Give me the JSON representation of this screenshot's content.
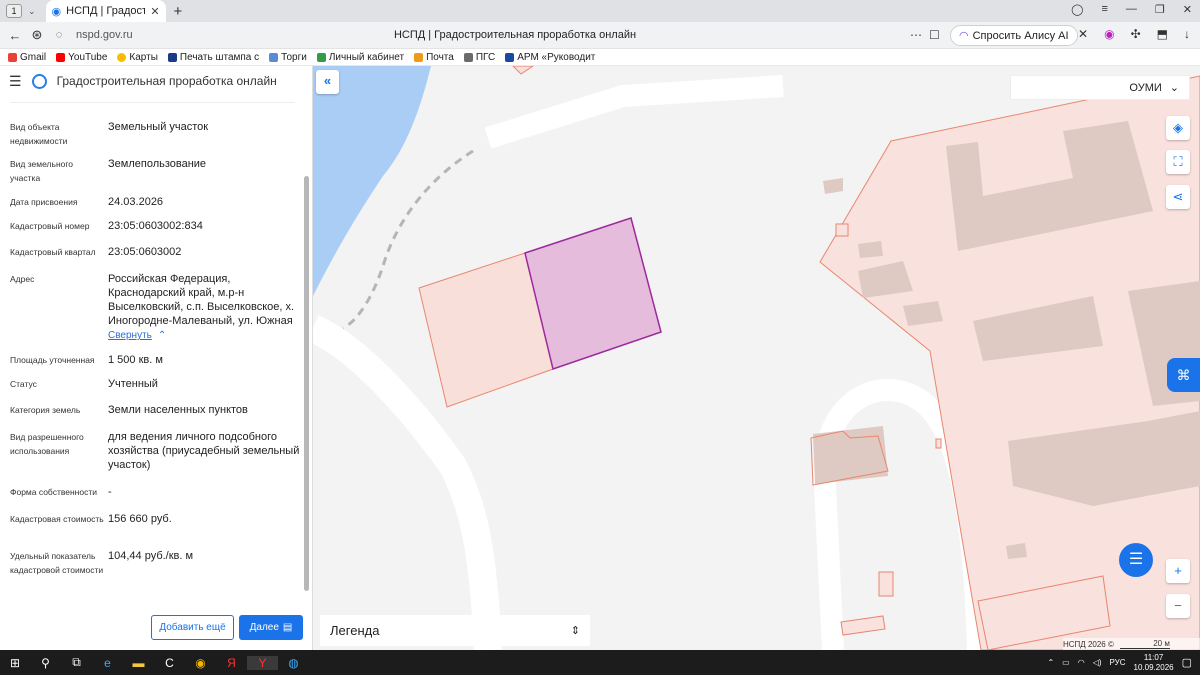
{
  "browser": {
    "tab_number": "1",
    "tab_title": "НСПД | Градостроительная проработка онлайн",
    "url": "nspd.gov.ru",
    "page_title": "НСПД | Градостроительная проработка онлайн",
    "alice_label": "Спросить Алису AI"
  },
  "bookmarks": [
    {
      "label": "Gmail",
      "color": "#ea4335"
    },
    {
      "label": "YouTube",
      "color": "#ff0000"
    },
    {
      "label": "Карты",
      "color": "#fbbc04"
    },
    {
      "label": "Печать штампа с",
      "color": "#1b3a8a"
    },
    {
      "label": "Торги",
      "color": "#5b8bd8"
    },
    {
      "label": "Личный кабинет",
      "color": "#2f9e44"
    },
    {
      "label": "Почта",
      "color": "#f09a1a"
    },
    {
      "label": "ПГС",
      "color": "#6b6b6b"
    },
    {
      "label": "АРМ «Руководит",
      "color": "#1a4aa0"
    }
  ],
  "sidebar": {
    "title": "Градостроительная проработка онлайн",
    "rows": [
      {
        "label": "Вид объекта недвижимости",
        "value": "Земельный участок"
      },
      {
        "label": "Вид земельного участка",
        "value": "Землепользование"
      },
      {
        "label": "Дата присвоения",
        "value": "24.03.2026"
      },
      {
        "label": "Кадастровый номер",
        "value": "23:05:0603002:834"
      },
      {
        "label": "Кадастровый квартал",
        "value": "23:05:0603002"
      },
      {
        "label": "Адрес",
        "value": "Российская Федерация, Краснодарский край, м.р-н Выселковский, с.п. Выселковское, х. Иногородне-Малеваный, ул. Южная",
        "link": "Свернуть"
      },
      {
        "label": "Площадь уточненная",
        "value": "1 500 кв. м"
      },
      {
        "label": "Статус",
        "value": "Учтенный"
      },
      {
        "label": "Категория земель",
        "value": "Земли населенных пунктов"
      },
      {
        "label": "Вид разрешенного использования",
        "value": "для ведения личного подсобного хозяйства (приусадебный земельный участок)"
      },
      {
        "label": "Форма собственности",
        "value": "-"
      },
      {
        "label": "Кадастровая стоимость",
        "value": "156 660 руб."
      },
      {
        "label": "Удельный показатель кадастровой стоимости",
        "value": "104,44 руб./кв. м"
      }
    ],
    "btn_add": "Добавить ещё",
    "btn_next": "Далее"
  },
  "map": {
    "layer_label": "ОУМИ",
    "legend_label": "Легенда",
    "copyright": "НСПД 2026 ©",
    "scale_label": "20 м"
  },
  "taskbar": {
    "lang": "РУС",
    "time": "11:07",
    "date": "10.09.2026"
  }
}
